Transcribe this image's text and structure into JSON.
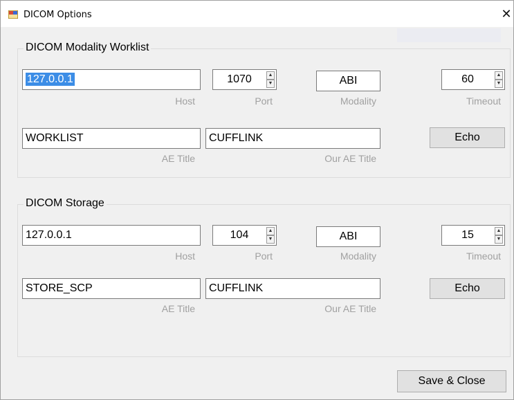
{
  "window": {
    "title": "DICOM Options",
    "close_glyph": "✕"
  },
  "worklist": {
    "legend": "DICOM Modality Worklist",
    "host": "127.0.0.1",
    "host_label": "Host",
    "port": "1070",
    "port_label": "Port",
    "modality": "ABI",
    "modality_label": "Modality",
    "timeout": "60",
    "timeout_label": "Timeout",
    "ae_title": "WORKLIST",
    "ae_title_label": "AE Title",
    "our_ae_title": "CUFFLINK",
    "our_ae_title_label": "Our AE Title",
    "echo_label": "Echo"
  },
  "storage": {
    "legend": "DICOM Storage",
    "host": "127.0.0.1",
    "host_label": "Host",
    "port": "104",
    "port_label": "Port",
    "modality": "ABI",
    "modality_label": "Modality",
    "timeout": "15",
    "timeout_label": "Timeout",
    "ae_title": "STORE_SCP",
    "ae_title_label": "AE Title",
    "our_ae_title": "CUFFLINK",
    "our_ae_title_label": "Our AE Title",
    "echo_label": "Echo"
  },
  "footer": {
    "save_label": "Save & Close"
  },
  "icons": {
    "app": "app-window-icon",
    "spin_up": "▲",
    "spin_down": "▼"
  }
}
